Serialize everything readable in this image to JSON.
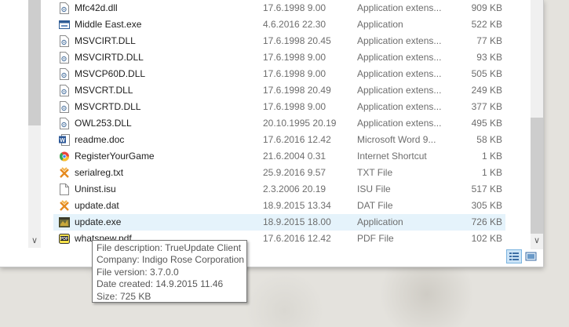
{
  "files": [
    {
      "name": "Mfc42d.dll",
      "date": "17.6.1998 9.00",
      "type": "Application extens...",
      "size": "909 KB",
      "icon": "dll-file-icon"
    },
    {
      "name": "Middle East.exe",
      "date": "4.6.2016 22.30",
      "type": "Application",
      "size": "522 KB",
      "icon": "app-window-icon"
    },
    {
      "name": "MSVCIRT.DLL",
      "date": "17.6.1998 20.45",
      "type": "Application extens...",
      "size": "77 KB",
      "icon": "dll-file-icon"
    },
    {
      "name": "MSVCIRTD.DLL",
      "date": "17.6.1998 9.00",
      "type": "Application extens...",
      "size": "93 KB",
      "icon": "dll-file-icon"
    },
    {
      "name": "MSVCP60D.DLL",
      "date": "17.6.1998 9.00",
      "type": "Application extens...",
      "size": "505 KB",
      "icon": "dll-file-icon"
    },
    {
      "name": "MSVCRT.DLL",
      "date": "17.6.1998 20.49",
      "type": "Application extens...",
      "size": "249 KB",
      "icon": "dll-file-icon"
    },
    {
      "name": "MSVCRTD.DLL",
      "date": "17.6.1998 9.00",
      "type": "Application extens...",
      "size": "377 KB",
      "icon": "dll-file-icon"
    },
    {
      "name": "OWL253.DLL",
      "date": "20.10.1995 20.19",
      "type": "Application extens...",
      "size": "495 KB",
      "icon": "dll-file-icon"
    },
    {
      "name": "readme.doc",
      "date": "17.6.2016 12.42",
      "type": "Microsoft Word 9...",
      "size": "58 KB",
      "icon": "word-doc-icon"
    },
    {
      "name": "RegisterYourGame",
      "date": "21.6.2004 0.31",
      "type": "Internet Shortcut",
      "size": "1 KB",
      "icon": "internet-shortcut-icon"
    },
    {
      "name": "serialreg.txt",
      "date": "25.9.2016 9.57",
      "type": "TXT File",
      "size": "1 KB",
      "icon": "txt-file-icon"
    },
    {
      "name": "Uninst.isu",
      "date": "2.3.2006 20.19",
      "type": "ISU File",
      "size": "517 KB",
      "icon": "blank-file-icon"
    },
    {
      "name": "update.dat",
      "date": "18.9.2015 13.34",
      "type": "DAT File",
      "size": "305 KB",
      "icon": "dat-file-icon"
    },
    {
      "name": "update.exe",
      "date": "18.9.2015 18.00",
      "type": "Application",
      "size": "726 KB",
      "icon": "update-app-icon"
    },
    {
      "name": "whatsnew.pdf",
      "date": "17.6.2016 12.42",
      "type": "PDF File",
      "size": "102 KB",
      "icon": "pdf-file-icon"
    }
  ],
  "hovered_index": 13,
  "tooltip": {
    "description": "File description: TrueUpdate Client",
    "company": "Company: Indigo Rose Corporation",
    "version": "File version: 3.7.0.0",
    "created": "Date created: 14.9.2015 11.46",
    "size": "Size: 725 KB"
  },
  "colors": {
    "hover_row": "#e5f3fb",
    "selected_view": "#cce4f7",
    "scroll_thumb": "#cdcdcd"
  }
}
